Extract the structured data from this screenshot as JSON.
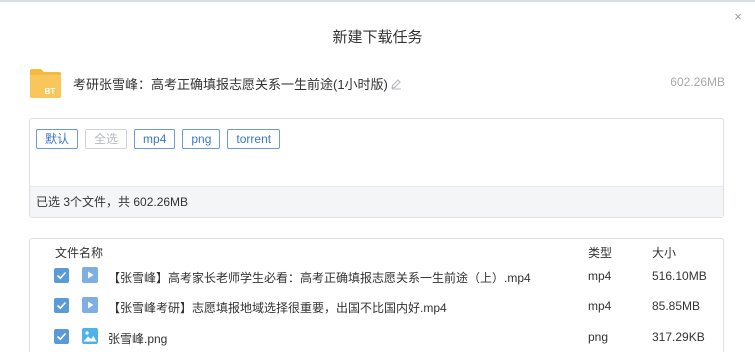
{
  "dialog": {
    "title": "新建下载任务",
    "close_glyph": "×"
  },
  "task": {
    "icon": "bt-folder-icon",
    "icon_label": "BT",
    "name": "考研张雪峰：高考正确填报志愿关系一生前途(1小时版)",
    "total_size": "602.26MB"
  },
  "filters": {
    "tags": [
      {
        "label": "默认",
        "enabled": true
      },
      {
        "label": "全选",
        "enabled": false
      },
      {
        "label": "mp4",
        "enabled": true
      },
      {
        "label": "png",
        "enabled": true
      },
      {
        "label": "torrent",
        "enabled": true
      }
    ],
    "status": "已选 3个文件，共 602.26MB"
  },
  "file_list": {
    "columns": {
      "name": "文件名称",
      "type": "类型",
      "size": "大小"
    },
    "rows": [
      {
        "checked": true,
        "icon": "video-icon",
        "name": "【张雪峰】高考家长老师学生必看：高考正确填报志愿关系一生前途（上）.mp4",
        "type": "mp4",
        "size": "516.10MB"
      },
      {
        "checked": true,
        "icon": "video-icon",
        "name": "【张雪峰考研】志愿填报地域选择很重要，出国不比国内好.mp4",
        "type": "mp4",
        "size": "85.85MB"
      },
      {
        "checked": true,
        "icon": "image-icon",
        "name": "张雪峰.png",
        "type": "png",
        "size": "317.29KB"
      }
    ]
  },
  "colors": {
    "accent": "#5b9bd5",
    "tag_border": "#6b9bd1",
    "bt_folder": "#f5b93d"
  }
}
